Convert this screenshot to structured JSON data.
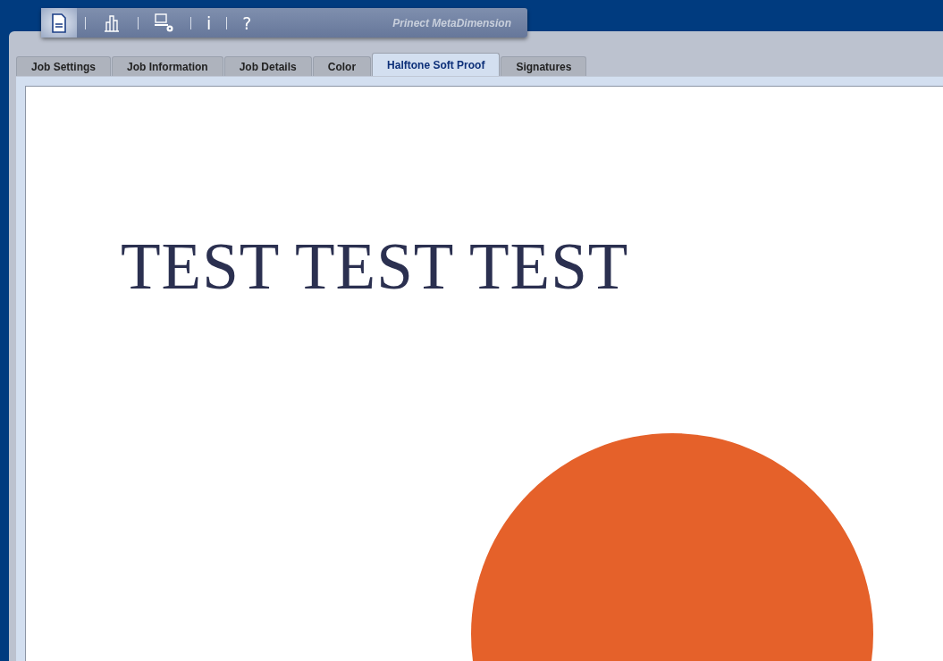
{
  "toolbar": {
    "items": [
      {
        "kind": "document",
        "selected": true
      },
      {
        "kind": "chart",
        "selected": false
      },
      {
        "kind": "computer",
        "selected": false
      },
      {
        "kind": "text",
        "label": "i",
        "selected": false
      },
      {
        "kind": "text",
        "label": "?",
        "selected": false
      }
    ],
    "brand": "Prinect MetaDimension"
  },
  "tabs": [
    {
      "label": "Job Settings",
      "selected": false
    },
    {
      "label": "Job Information",
      "selected": false
    },
    {
      "label": "Job Details",
      "selected": false
    },
    {
      "label": "Color",
      "selected": false
    },
    {
      "label": "Halftone Soft Proof",
      "selected": true
    },
    {
      "label": "Signatures",
      "selected": false
    }
  ],
  "proof": {
    "heading": "TEST TEST TEST"
  }
}
